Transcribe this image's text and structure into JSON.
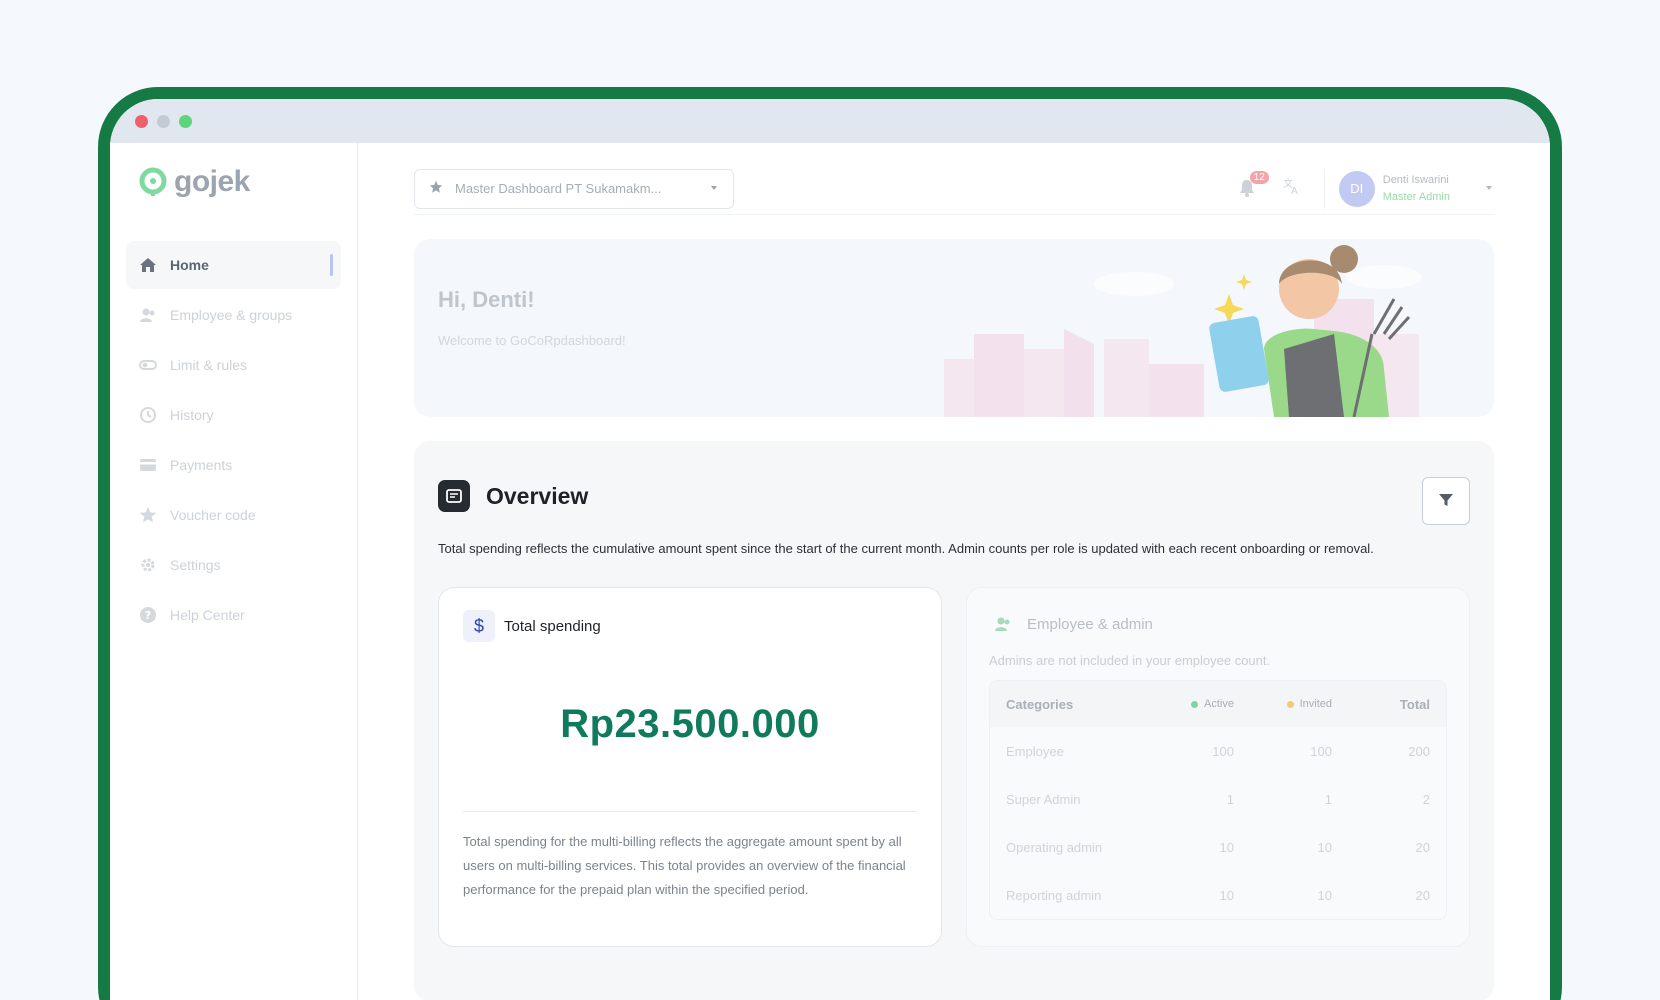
{
  "brand": {
    "name": "gojek",
    "color": "#00aa13"
  },
  "sidebar": {
    "items": [
      {
        "label": "Home",
        "icon": "home-icon",
        "active": true
      },
      {
        "label": "Employee & groups",
        "icon": "users-icon"
      },
      {
        "label": "Limit & rules",
        "icon": "toggle-icon"
      },
      {
        "label": "History",
        "icon": "history-icon"
      },
      {
        "label": "Payments",
        "icon": "card-icon"
      },
      {
        "label": "Voucher code",
        "icon": "star-icon"
      },
      {
        "label": "Settings",
        "icon": "gear-icon"
      },
      {
        "label": "Help Center",
        "icon": "help-icon"
      }
    ]
  },
  "topbar": {
    "dashboard_select": "Master Dashboard PT Sukamakm...",
    "notification_count": "12",
    "user": {
      "initials": "DI",
      "name": "Denti Iswarini",
      "role": "Master Admin"
    }
  },
  "hero": {
    "title": "Hi, Denti!",
    "subtitle": "Welcome to GoCoRpdashboard!"
  },
  "overview": {
    "title": "Overview",
    "description": "Total spending reflects the cumulative amount spent since the start of the current month. Admin counts per role is updated with each recent onboarding or removal.",
    "total_spending": {
      "title": "Total spending",
      "currency_symbol": "$",
      "amount": "Rp23.500.000",
      "description": "Total spending for the multi-billing reflects the aggregate amount spent by all users on multi-billing services. This total provides an overview of the financial performance for the prepaid plan within the specified period."
    },
    "employee_admin": {
      "title": "Employee & admin",
      "subtitle": "Admins are not included in your employee count.",
      "headers": {
        "category": "Categories",
        "active": "Active",
        "invited": "Invited",
        "total": "Total"
      },
      "status_colors": {
        "active": "#7fd3a3",
        "invited": "#f2c879"
      },
      "rows": [
        {
          "category": "Employee",
          "active": "100",
          "invited": "100",
          "total": "200"
        },
        {
          "category": "Super Admin",
          "active": "1",
          "invited": "1",
          "total": "2"
        },
        {
          "category": "Operating admin",
          "active": "10",
          "invited": "10",
          "total": "20"
        },
        {
          "category": "Reporting admin",
          "active": "10",
          "invited": "10",
          "total": "20"
        }
      ]
    }
  }
}
